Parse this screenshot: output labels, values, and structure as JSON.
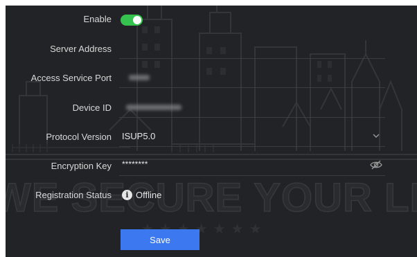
{
  "form": {
    "enable": {
      "label": "Enable",
      "checked": true
    },
    "server_address": {
      "label": "Server Address",
      "value": ""
    },
    "access_service_port": {
      "label": "Access Service Port"
    },
    "device_id": {
      "label": "Device ID"
    },
    "protocol_version": {
      "label": "Protocol Version",
      "value": "ISUP5.0"
    },
    "encryption_key": {
      "label": "Encryption Key",
      "value": "********"
    },
    "registration_status": {
      "label": "Registration Status",
      "value": "Offline"
    },
    "save_label": "Save"
  },
  "background": {
    "slogan": "WE SECURE YOUR LIFE",
    "stars": "★★★★★★★"
  },
  "colors": {
    "panel_bg": "#222326",
    "toggle_on": "#36c24e",
    "primary_button": "#3c78f0",
    "text": "#d9d9d9"
  },
  "icons": {
    "dropdown": "chevron-down-icon",
    "visibility": "eye-off-icon",
    "status": "info-icon"
  }
}
